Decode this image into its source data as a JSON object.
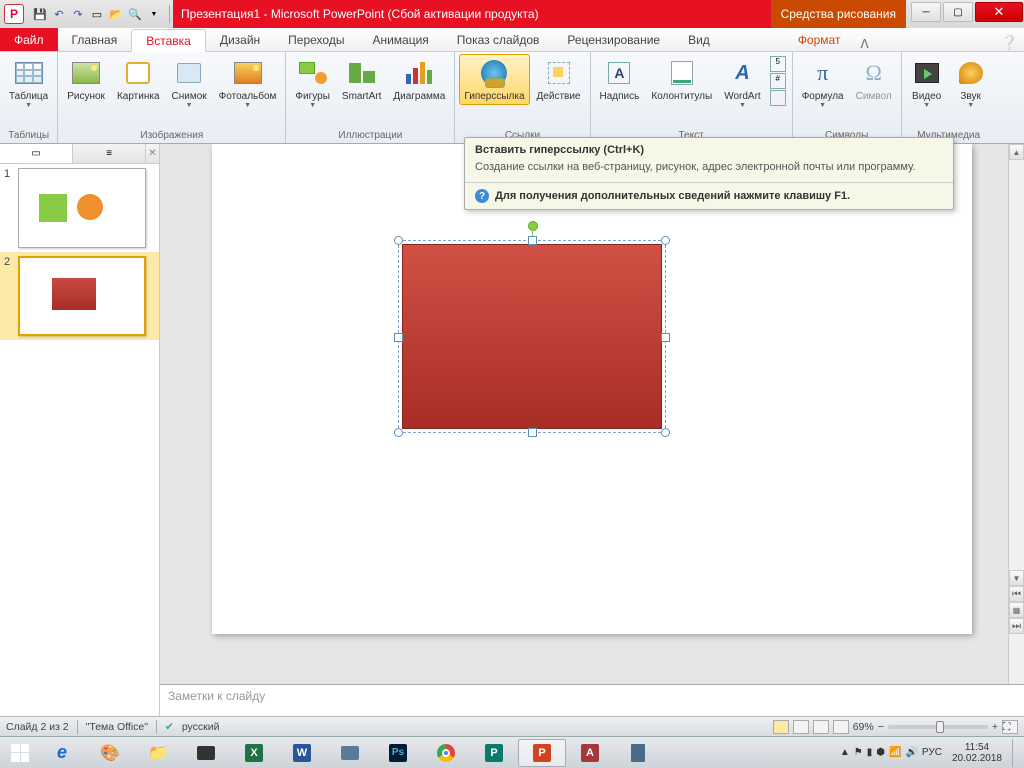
{
  "titlebar": {
    "app_letter": "P",
    "title": "Презентация1 - Microsoft PowerPoint (Сбой активации продукта)",
    "tools_tab": "Средства рисования"
  },
  "tabs": {
    "file": "Файл",
    "home": "Главная",
    "insert": "Вставка",
    "design": "Дизайн",
    "transitions": "Переходы",
    "animation": "Анимация",
    "slideshow": "Показ слайдов",
    "review": "Рецензирование",
    "view": "Вид",
    "format": "Формат"
  },
  "ribbon": {
    "tables": {
      "table": "Таблица",
      "group": "Таблицы"
    },
    "images": {
      "picture": "Рисунок",
      "clipart": "Картинка",
      "screenshot": "Снимок",
      "album": "Фотоальбом",
      "group": "Изображения"
    },
    "illus": {
      "shapes": "Фигуры",
      "smartart": "SmartArt",
      "chart": "Диаграмма",
      "group": "Иллюстрации"
    },
    "links": {
      "hyperlink": "Гиперссылка",
      "action": "Действие",
      "group": "Ссылки"
    },
    "text": {
      "textbox": "Надпись",
      "headerfooter": "Колонтитулы",
      "wordart": "WordArt",
      "group": "Текст"
    },
    "symbols": {
      "equation": "Формула",
      "symbol": "Символ",
      "group": "Символы"
    },
    "media": {
      "video": "Видео",
      "audio": "Звук",
      "group": "Мультимедиа"
    }
  },
  "tooltip": {
    "title": "Вставить гиперссылку (Ctrl+K)",
    "body": "Создание ссылки на веб-страницу, рисунок, адрес электронной почты или программу.",
    "help": "Для получения дополнительных сведений нажмите клавишу F1."
  },
  "thumbs": {
    "n1": "1",
    "n2": "2"
  },
  "notes": {
    "placeholder": "Заметки к слайду"
  },
  "status": {
    "slide": "Слайд 2 из 2",
    "theme": "\"Тема Office\"",
    "lang": "русский",
    "zoom": "69%"
  },
  "tray": {
    "lang": "РУС",
    "time": "11:54",
    "date": "20.02.2018"
  }
}
